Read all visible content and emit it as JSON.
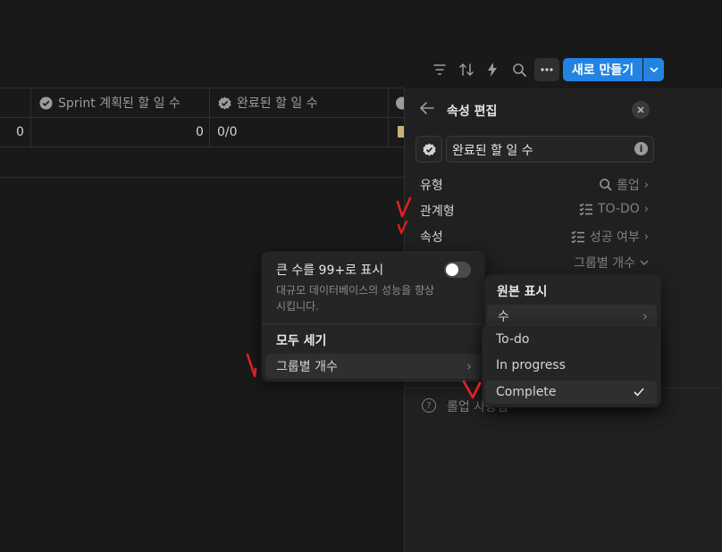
{
  "toolbar": {
    "icons": [
      "filter-icon",
      "sort-icon",
      "lightning-icon",
      "search-icon",
      "more-icon"
    ],
    "new_button": "새로 만들기"
  },
  "table": {
    "columns": [
      {
        "label": "Sprint 계획된 할 일 수",
        "icon": "rollup-check-icon"
      },
      {
        "label": "완료된 할 일 수",
        "icon": "rollup-check-icon"
      }
    ],
    "row": {
      "col0": "0",
      "col1": "0",
      "col2": "0/0"
    }
  },
  "panel": {
    "title": "속성 편집",
    "name_value": "완료된 할 일 수",
    "rows": [
      {
        "label": "유형",
        "value": "롤업",
        "icon": "search-icon"
      },
      {
        "label": "관계형",
        "value": "TO-DO",
        "icon": "checklist-icon"
      },
      {
        "label": "속성",
        "value": "성공 여부",
        "icon": "checklist-icon"
      }
    ],
    "calc_value": "그룹별 개수",
    "help_text": "롤업 사용법"
  },
  "calc_menu": {
    "toggle_label": "큰 수를 99+로 표시",
    "toggle_desc": "대규모 데이터베이스의 성능을 향상시킵니다.",
    "toggle_on": false,
    "count_all": "모두 세기",
    "count_per_group": "그룹별 개수"
  },
  "show_menu": {
    "header": "원본 표시",
    "number": "수"
  },
  "status_menu": {
    "options": [
      "To-do",
      "In progress",
      "Complete"
    ],
    "selected": "Complete"
  },
  "colors": {
    "background": "#191919",
    "accent": "#2383e2",
    "annotation": "#e02020"
  }
}
